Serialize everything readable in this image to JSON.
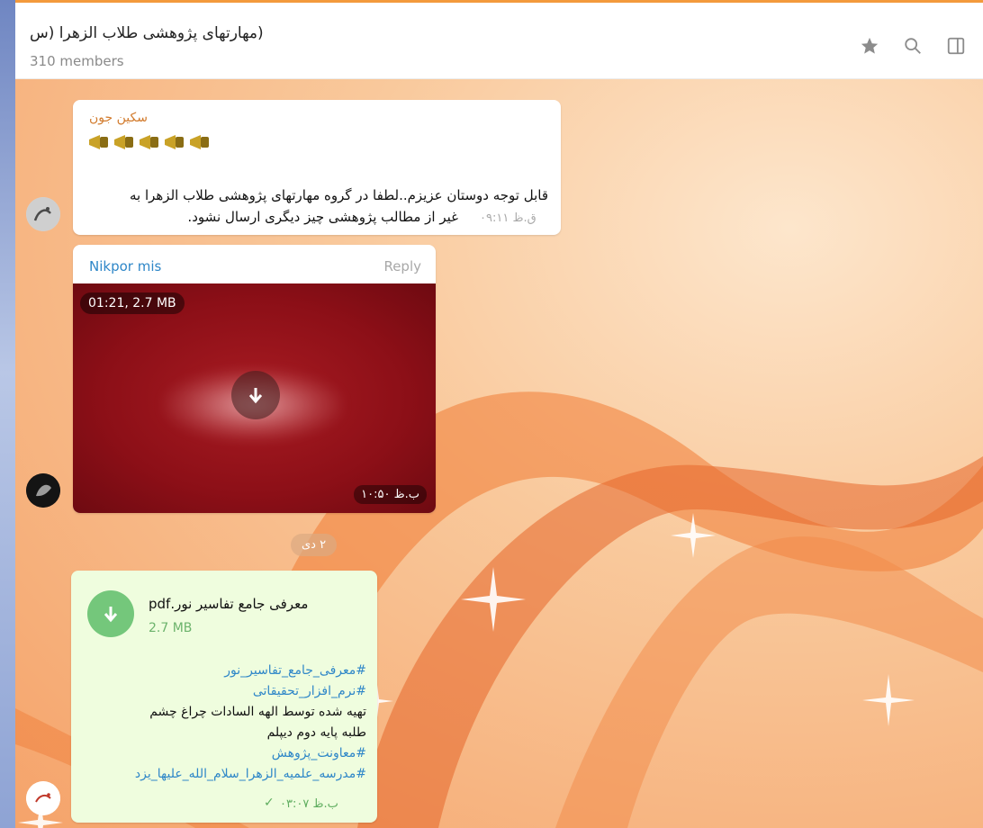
{
  "header": {
    "title": "(مهارتهای پژوهشی طلاب الزهرا (س",
    "subtitle": "310 members",
    "icons": [
      "star-icon",
      "search-icon",
      "sidebar-toggle-icon"
    ]
  },
  "colors": {
    "accent_top": "#f39a3c",
    "link": "#2f87c8",
    "sender_orange": "#d27b2d",
    "outgoing_bubble": "#effdde"
  },
  "messages": [
    {
      "sender": "سکین جون",
      "emoji": "📣📣📣📣📣",
      "text_line1": "قابل توجه دوستان عزیزم..لطفا در گروه مهارتهای پژوهشی طلاب الزهرا به",
      "text_line2": "غیر از مطالب پژوهشی چیز دیگری ارسال نشود.",
      "time": "ق.ظ ۰۹:۱۱"
    },
    {
      "sender": "Nikpor mis",
      "reply_label": "Reply",
      "video_info": "01:21, 2.7 MB",
      "time": "ب.ظ ۱۰:۵۰"
    },
    {
      "file_name": "معرفی جامع تفاسیر نور.pdf",
      "file_size": "2.7 MB",
      "caption_lines": [
        "#معرفی_جامع_تفاسیر_نور",
        "#نرم_افزار_تحقیقاتی",
        "تهیه شده توسط الهه السادات چراغ چشم",
        "طلبه پایه دوم دیپلم",
        "#معاونت_پژوهش",
        "#مدرسه_علمیه_الزهرا_سلام_الله_علیها_یزد"
      ],
      "time": "ب.ظ ۰۳:۰۷"
    }
  ],
  "date_separator": "۲ دی"
}
